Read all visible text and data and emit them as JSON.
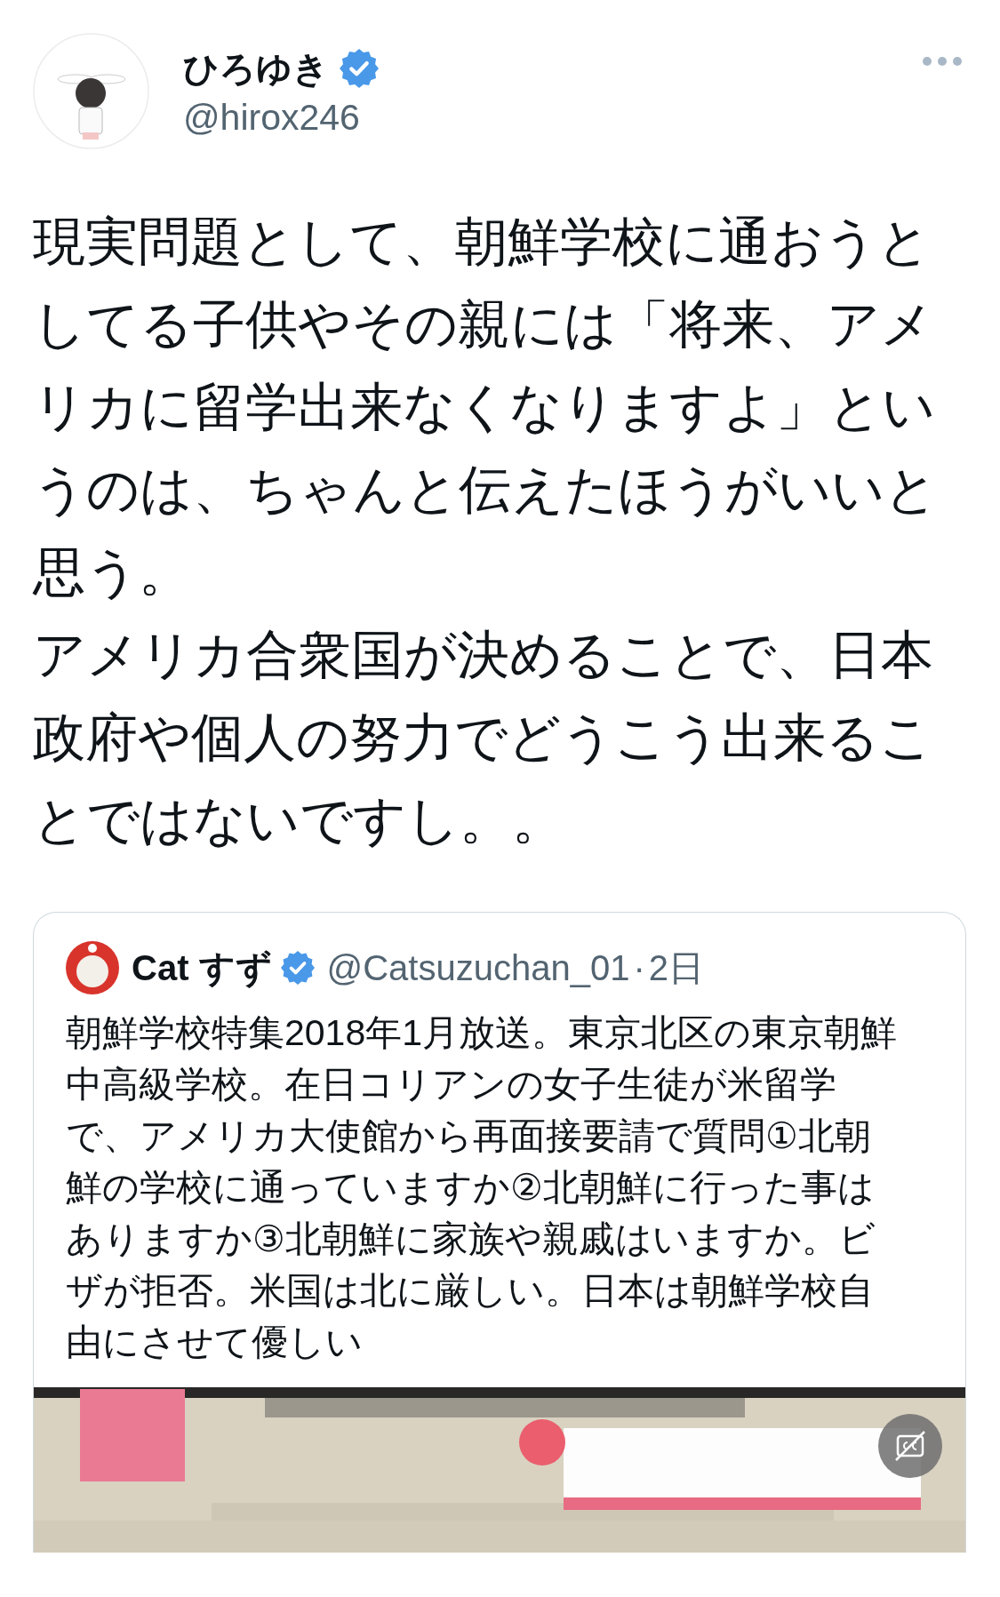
{
  "author": {
    "name": "ひろゆき",
    "verified": true,
    "handle": "@hirox246"
  },
  "paragraphs": [
    "現実問題として、朝鮮学校に通おうとしてる子供やその親には「将来、アメリカに留学出来なくなりますよ」というのは、ちゃんと伝えたほうがいいと思う。",
    "アメリカ合衆国が決めることで、日本政府や個人の努力でどうこう出来ることではないですし。。"
  ],
  "quote": {
    "author": {
      "name": "Cat すず",
      "verified": true,
      "handle": "@Catsuzuchan_01",
      "separator": "·",
      "time": "2日"
    },
    "text": "朝鮮学校特集2018年1月放送。東京北区の東京朝鮮中高級学校。在日コリアンの女子生徒が米留学で、アメリカ大使館から再面接要請で質問①北朝鮮の学校に通っていますか②北朝鮮に行った事はありますか③北朝鮮に家族や親戚はいますか。ビザが拒否。米国は北に厳しい。日本は朝鮮学校自由にさせて優しい"
  }
}
